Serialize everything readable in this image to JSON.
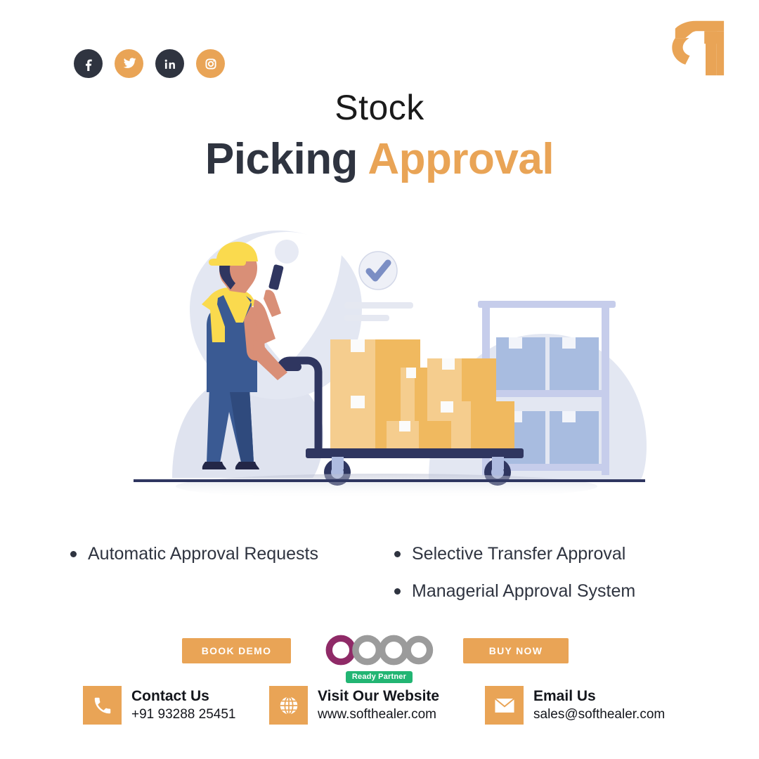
{
  "brand": {
    "logo_icon": "softhealer-logo-icon",
    "accent_color": "#e9a456",
    "dark_color": "#2f3440"
  },
  "social": {
    "items": [
      {
        "name": "facebook-icon",
        "label": "Facebook",
        "style": "dark"
      },
      {
        "name": "twitter-icon",
        "label": "Twitter",
        "style": "orange"
      },
      {
        "name": "linkedin-icon",
        "label": "LinkedIn",
        "style": "dark"
      },
      {
        "name": "instagram-icon",
        "label": "Instagram",
        "style": "orange"
      }
    ]
  },
  "title": {
    "line1": "Stock",
    "line2_dark": "Picking ",
    "line2_accent": "Approval"
  },
  "illustration": {
    "alt": "warehouse worker pushing cart with boxes",
    "approval_check": "check-circle-icon"
  },
  "features": {
    "left": [
      "Automatic Approval Requests"
    ],
    "right": [
      "Selective Transfer Approval",
      "Managerial Approval System"
    ]
  },
  "cta": {
    "book_demo": "BOOK DEMO",
    "buy_now": "BUY NOW",
    "odoo_name": "odoo",
    "odoo_badge": "Ready Partner"
  },
  "contacts": [
    {
      "icon": "phone-icon",
      "title": "Contact Us",
      "value": "+91 93288 25451"
    },
    {
      "icon": "globe-icon",
      "title": "Visit Our Website",
      "value": "www.softhealer.com"
    },
    {
      "icon": "envelope-icon",
      "title": "Email Us",
      "value": "sales@softhealer.com"
    }
  ]
}
